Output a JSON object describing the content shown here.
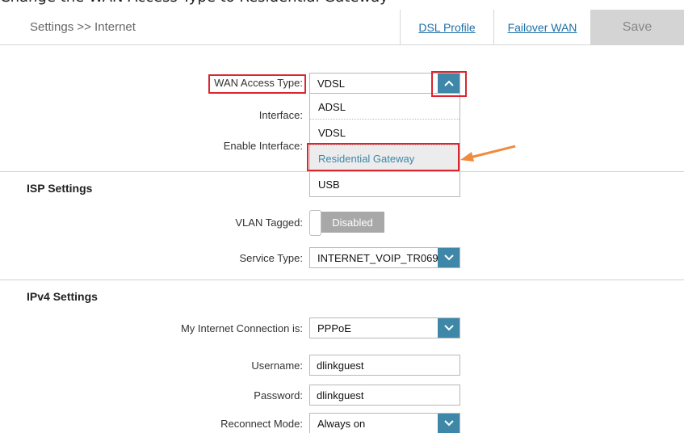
{
  "caption": "Change the WAN Access Type to Residential Gateway",
  "header": {
    "breadcrumb": "Settings >> Internet",
    "dsl_profile": "DSL Profile",
    "failover_wan": "Failover WAN",
    "save": "Save"
  },
  "wan": {
    "access_type_label": "WAN Access Type:",
    "access_type_value": "VDSL",
    "interface_label": "Interface:",
    "enable_interface_label": "Enable Interface:",
    "options": [
      "ADSL",
      "VDSL",
      "Residential Gateway",
      "USB"
    ],
    "highlighted_option": "Residential Gateway"
  },
  "isp": {
    "title": "ISP Settings",
    "vlan_label": "VLAN Tagged:",
    "vlan_state": "Disabled",
    "service_type_label": "Service Type:",
    "service_type_value": "INTERNET_VOIP_TR069"
  },
  "ipv4": {
    "title": "IPv4 Settings",
    "connection_label": "My Internet Connection is:",
    "connection_value": "PPPoE",
    "username_label": "Username:",
    "username_value": "dlinkguest",
    "password_label": "Password:",
    "password_value": "dlinkguest",
    "reconnect_label": "Reconnect Mode:",
    "reconnect_value": "Always on"
  },
  "colors": {
    "accent": "#3e87a8",
    "annotation_red": "#d9262f",
    "annotation_arrow": "#f08a3c",
    "link": "#1e6fa6"
  }
}
